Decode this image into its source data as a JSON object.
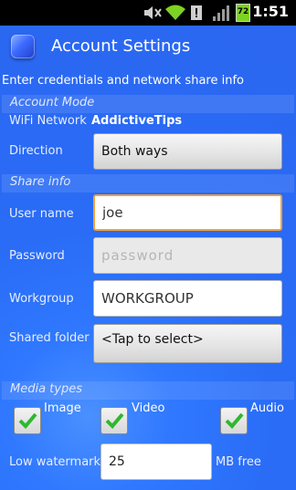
{
  "status_bar": {
    "icons": [
      "mute-icon",
      "wifi-icon",
      "alert-icon",
      "signal-icon",
      "battery-icon"
    ],
    "battery_level": "72",
    "time": "1:51"
  },
  "header": {
    "title": "Account Settings",
    "subtitle": "Enter credentials and network share info"
  },
  "account_mode": {
    "section_title": "Account Mode",
    "wifi_label": "WiFi Network",
    "wifi_value": "AddictiveTips",
    "direction_label": "Direction",
    "direction_value": "Both ways"
  },
  "share_info": {
    "section_title": "Share info",
    "username_label": "User name",
    "username_value": "joe",
    "password_label": "Password",
    "password_placeholder": "password",
    "workgroup_label": "Workgroup",
    "workgroup_value": "WORKGROUP",
    "shared_folder_label": "Shared folder",
    "shared_folder_value": "<Tap to select>"
  },
  "media_types": {
    "section_title": "Media types",
    "items": [
      {
        "label": "Image",
        "checked": true
      },
      {
        "label": "Video",
        "checked": true
      },
      {
        "label": "Audio",
        "checked": true
      }
    ]
  },
  "watermark": {
    "label": "Low watermark",
    "value": "25",
    "unit": "MB free"
  },
  "colors": {
    "accent_check": "#2fb82f",
    "focus_border": "#f0a23a",
    "background": "#2b66f0"
  }
}
